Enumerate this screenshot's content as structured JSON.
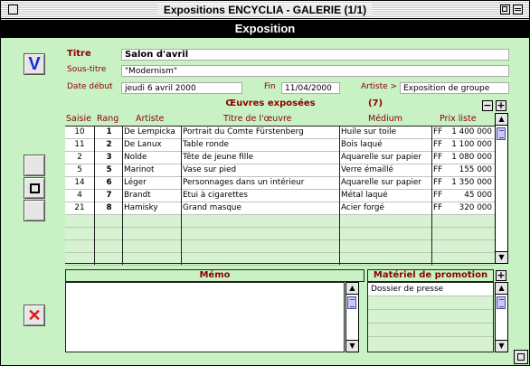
{
  "window": {
    "title": "Expositions ENCYCLIA - GALERIE (1/1)"
  },
  "header": {
    "title": "Exposition"
  },
  "buttons": {
    "validate": "V",
    "cancel": "✕"
  },
  "form": {
    "titre_label": "Titre",
    "titre_value": "Salon d'avril",
    "sous_titre_label": "Sous-titre",
    "sous_titre_value": "\"Modernism\"",
    "date_debut_label": "Date début",
    "date_debut_value": "jeudi 6 avril 2000",
    "fin_label": "Fin",
    "fin_value": "11/04/2000",
    "artiste_label": "Artiste >",
    "artiste_value": "Exposition de groupe"
  },
  "oeuvres": {
    "title": "Œuvres exposées",
    "count": "(7)",
    "minus": "−",
    "plus": "+",
    "columns": [
      "Saisie",
      "Rang",
      "Artiste",
      "Titre de l'œuvre",
      "Médium",
      "Prix liste"
    ],
    "rows": [
      {
        "saisie": "10",
        "rang": "1",
        "artiste": "De Lempicka",
        "titre": "Portrait du Comte Fürstenberg",
        "medium": "Huile sur toile",
        "cur": "FF",
        "prix": "1 400 000"
      },
      {
        "saisie": "11",
        "rang": "2",
        "artiste": "De Lanux",
        "titre": "Table ronde",
        "medium": "Bois laqué",
        "cur": "FF",
        "prix": "1 100 000"
      },
      {
        "saisie": "2",
        "rang": "3",
        "artiste": "Nolde",
        "titre": "Tête de jeune fille",
        "medium": "Aquarelle sur papier",
        "cur": "FF",
        "prix": "1 080 000"
      },
      {
        "saisie": "5",
        "rang": "5",
        "artiste": "Marinot",
        "titre": "Vase sur pied",
        "medium": "Verre émaillé",
        "cur": "FF",
        "prix": "155 000"
      },
      {
        "saisie": "14",
        "rang": "6",
        "artiste": "Léger",
        "titre": "Personnages dans un intérieur",
        "medium": "Aquarelle sur papier",
        "cur": "FF",
        "prix": "1 350 000"
      },
      {
        "saisie": "4",
        "rang": "7",
        "artiste": "Brandt",
        "titre": "Etui à cigarettes",
        "medium": "Métal laqué",
        "cur": "FF",
        "prix": "45 000"
      },
      {
        "saisie": "21",
        "rang": "8",
        "artiste": "Hamisky",
        "titre": "Grand masque",
        "medium": "Acier forgé",
        "cur": "FF",
        "prix": "320 000"
      }
    ]
  },
  "memo": {
    "title": "Mémo",
    "value": ""
  },
  "promo": {
    "title": "Matériel de promotion",
    "plus": "+",
    "items": [
      "Dossier de presse"
    ]
  },
  "icons": [
    "close-box-icon",
    "zoom-box-icon",
    "collapse-box-icon",
    "validate-icon",
    "cancel-icon",
    "record-up-icon",
    "record-stop-icon",
    "record-down-icon",
    "scroll-up-icon",
    "scroll-down-icon",
    "scroll-thumb-icon",
    "grow-box-icon"
  ]
}
